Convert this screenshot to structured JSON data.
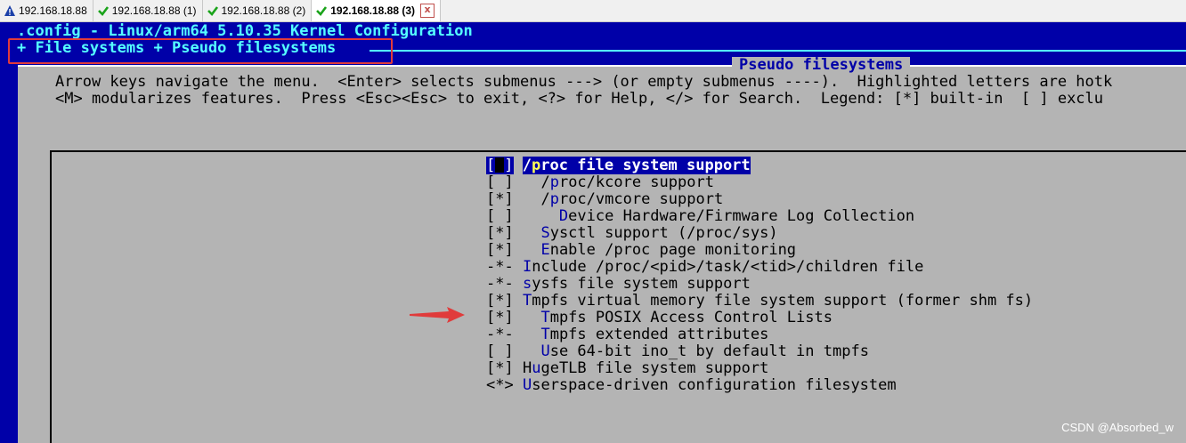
{
  "tabs": [
    {
      "label": "192.168.18.88",
      "status": "warning"
    },
    {
      "label": "192.168.18.88 (1)",
      "status": "ok"
    },
    {
      "label": "192.168.18.88 (2)",
      "status": "ok"
    },
    {
      "label": "192.168.18.88 (3)",
      "status": "ok",
      "active": true
    }
  ],
  "tab_close_glyph": "x",
  "terminal": {
    "title": ".config - Linux/arm64 5.10.35 Kernel Configuration",
    "breadcrumb": "+ File systems + Pseudo filesystems",
    "dialog_title": "Pseudo filesystems",
    "help_line1": "Arrow keys navigate the menu.  <Enter> selects submenus ---> (or empty submenus ----).  Highlighted letters are hotk",
    "help_line2": "<M> modularizes features.  Press <Esc><Esc> to exit, <?> for Help, </> for Search.  Legend: [*] built-in  [ ] exclu",
    "menu_items": [
      {
        "state": "[ ]",
        "indent": "",
        "prefix": "/",
        "hotkey": "p",
        "rest": "roc file system support",
        "selected": true
      },
      {
        "state": "[ ]",
        "indent": "  ",
        "prefix": "/",
        "hotkey": "p",
        "rest": "roc/kcore support"
      },
      {
        "state": "[*]",
        "indent": "  ",
        "prefix": "/",
        "hotkey": "p",
        "rest": "roc/vmcore support"
      },
      {
        "state": "[ ]",
        "indent": "    ",
        "prefix": "",
        "hotkey": "D",
        "rest": "evice Hardware/Firmware Log Collection"
      },
      {
        "state": "[*]",
        "indent": "  ",
        "prefix": "",
        "hotkey": "S",
        "rest": "ysctl support (/proc/sys)"
      },
      {
        "state": "[*]",
        "indent": "  ",
        "prefix": "",
        "hotkey": "E",
        "rest": "nable /proc page monitoring"
      },
      {
        "state": "-*-",
        "indent": "",
        "prefix": "",
        "hotkey": "I",
        "rest": "nclude /proc/<pid>/task/<tid>/children file"
      },
      {
        "state": "-*-",
        "indent": "",
        "prefix": "",
        "hotkey": "s",
        "rest": "ysfs file system support"
      },
      {
        "state": "[*]",
        "indent": "",
        "prefix": "",
        "hotkey": "T",
        "rest": "mpfs virtual memory file system support (former shm fs)"
      },
      {
        "state": "[*]",
        "indent": "  ",
        "prefix": "",
        "hotkey": "T",
        "rest": "mpfs POSIX Access Control Lists"
      },
      {
        "state": "-*-",
        "indent": "  ",
        "prefix": "",
        "hotkey": "T",
        "rest": "mpfs extended attributes"
      },
      {
        "state": "[ ]",
        "indent": "  ",
        "prefix": "",
        "hotkey": "U",
        "rest": "se 64-bit ino_t by default in tmpfs"
      },
      {
        "state": "[*]",
        "indent": "",
        "prefix": "H",
        "hotkey": "u",
        "rest": "geTLB file system support"
      },
      {
        "state": "<*>",
        "indent": "",
        "prefix": "",
        "hotkey": "U",
        "rest": "serspace-driven configuration filesystem"
      }
    ]
  },
  "watermark": "CSDN @Absorbed_w",
  "colors": {
    "terminal_bg": "#0000a8",
    "dialog_bg": "#b4b4b4",
    "title_text": "#55ffff",
    "hotkey": "#0000a8",
    "selected_hotkey": "#ffff55",
    "annotation_red": "#e03b3b"
  },
  "icons": {
    "warning": "warning-triangle-icon",
    "ok": "green-check-icon",
    "close": "close-icon",
    "annotation": "red-arrow-icon"
  }
}
